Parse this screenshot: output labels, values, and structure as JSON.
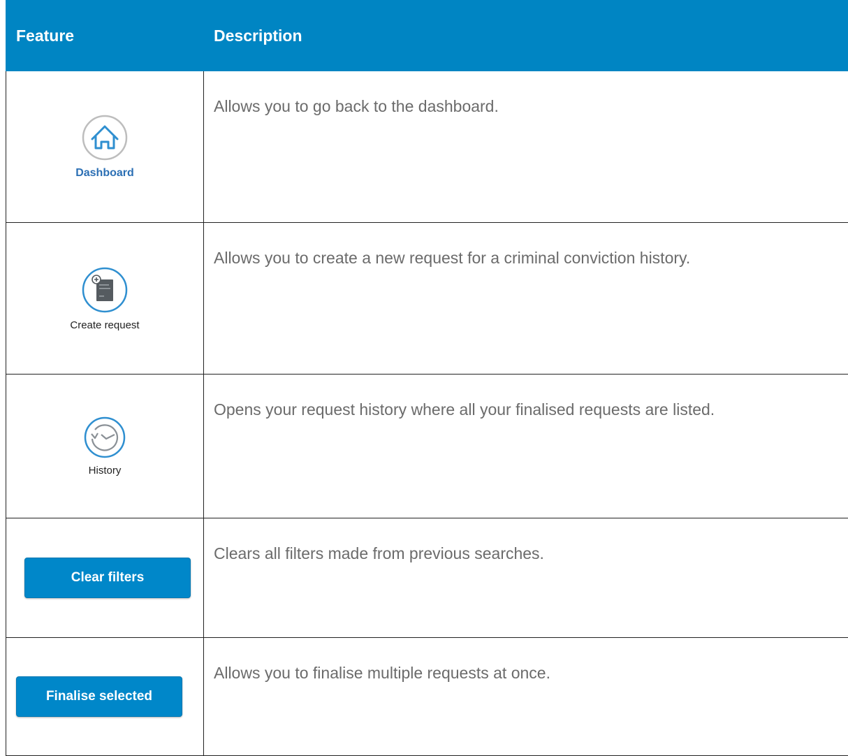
{
  "table": {
    "headers": {
      "feature": "Feature",
      "description": "Description"
    },
    "rows": [
      {
        "feature_type": "icon",
        "icon": "home-icon",
        "label": "Dashboard",
        "description": "Allows you to go back to the dashboard."
      },
      {
        "feature_type": "icon",
        "icon": "create-request-icon",
        "label": "Create request",
        "description": "Allows you to create a new request for a criminal conviction history."
      },
      {
        "feature_type": "icon",
        "icon": "history-icon",
        "label": "History",
        "description": "Opens your request history where all your finalised requests are listed."
      },
      {
        "feature_type": "button",
        "label": "Clear filters",
        "description": "Clears all filters made from previous searches."
      },
      {
        "feature_type": "button",
        "label": "Finalise selected",
        "description": "Allows you to finalise multiple requests at once."
      }
    ]
  },
  "colors": {
    "header_bg": "#0085c3",
    "button_bg": "#0087c9",
    "icon_ring": "#2f8fd0",
    "dashboard_label": "#2b6fb4",
    "description_text": "#6b6b6b"
  }
}
